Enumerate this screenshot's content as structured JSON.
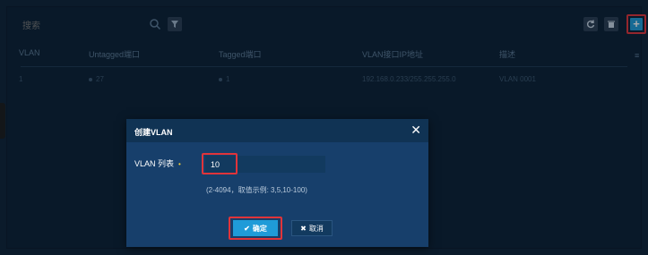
{
  "toolbar": {
    "search_placeholder": "搜索",
    "search_icon": "search-icon",
    "filter_icon": "filter-icon",
    "refresh_icon": "refresh-icon",
    "delete_icon": "trash-icon",
    "add_label": "+"
  },
  "table": {
    "columns": [
      "VLAN",
      "Untagged端口",
      "Tagged端口",
      "VLAN接口IP地址",
      "描述"
    ],
    "menu_icon": "≡",
    "rows": [
      [
        "1",
        "27",
        "1",
        "192.168.0.233/255.255.255.0",
        "VLAN 0001"
      ]
    ]
  },
  "modal": {
    "title": "创建VLAN",
    "close": "✕",
    "field_label": "VLAN 列表",
    "required_mark": "•",
    "input_value": "10",
    "hint": "(2-4094，取值示例: 3,5,10-100)",
    "confirm_label": "确定",
    "confirm_icon": "✔",
    "cancel_label": "取消",
    "cancel_icon": "✖"
  },
  "colors": {
    "accent": "#1f9bd8",
    "highlight": "#e0343a",
    "modal_bg": "#173f6b"
  }
}
